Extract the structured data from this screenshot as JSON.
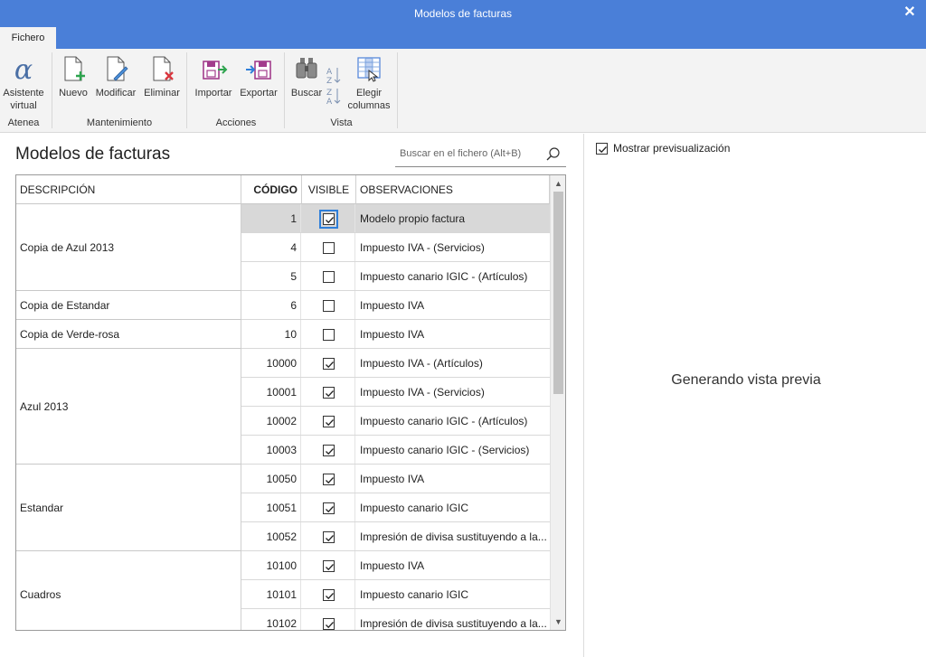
{
  "window": {
    "title": "Modelos de facturas",
    "close_glyph": "✕"
  },
  "tabs": [
    {
      "label": "Fichero"
    }
  ],
  "ribbon": {
    "groups": [
      {
        "label": "Atenea"
      },
      {
        "label": "Mantenimiento"
      },
      {
        "label": "Acciones"
      },
      {
        "label": "Vista"
      }
    ],
    "buttons": {
      "asistente": {
        "label1": "Asistente",
        "label2": "virtual",
        "icon": "alpha-icon"
      },
      "nuevo": {
        "label": "Nuevo",
        "icon": "new-document-icon"
      },
      "modificar": {
        "label": "Modificar",
        "icon": "edit-document-icon"
      },
      "eliminar": {
        "label": "Eliminar",
        "icon": "delete-document-icon"
      },
      "importar": {
        "label": "Importar",
        "icon": "import-icon"
      },
      "exportar": {
        "label": "Exportar",
        "icon": "export-icon"
      },
      "buscar": {
        "label": "Buscar",
        "icon": "binoculars-icon"
      },
      "ordenar": {
        "icon": "sort-az-icon"
      },
      "elegir": {
        "label1": "Elegir",
        "label2": "columnas",
        "icon": "choose-columns-icon"
      }
    }
  },
  "main": {
    "title": "Modelos de facturas",
    "search": {
      "placeholder": "Buscar en el fichero (Alt+B)",
      "icon": "search-icon"
    },
    "columns": {
      "descripcion": "DESCRIPCIÓN",
      "codigo": "CÓDIGO",
      "visible": "VISIBLE",
      "observaciones": "OBSERVACIONES"
    },
    "groups": [
      {
        "label": "Copia de Azul 2013",
        "rows": 3
      },
      {
        "label": "Copia de Estandar",
        "rows": 1
      },
      {
        "label": "Copia de Verde-rosa",
        "rows": 1
      },
      {
        "label": "Azul 2013",
        "rows": 4
      },
      {
        "label": "Estandar",
        "rows": 3
      },
      {
        "label": "Cuadros",
        "rows": 3
      }
    ],
    "rows": [
      {
        "code": "1",
        "visible": true,
        "obs": "Modelo propio factura",
        "selected": true
      },
      {
        "code": "4",
        "visible": false,
        "obs": "Impuesto IVA - (Servicios)"
      },
      {
        "code": "5",
        "visible": false,
        "obs": "Impuesto canario IGIC - (Artículos)"
      },
      {
        "code": "6",
        "visible": false,
        "obs": "Impuesto IVA"
      },
      {
        "code": "10",
        "visible": false,
        "obs": "Impuesto IVA"
      },
      {
        "code": "10000",
        "visible": true,
        "obs": "Impuesto IVA - (Artículos)"
      },
      {
        "code": "10001",
        "visible": true,
        "obs": "Impuesto IVA - (Servicios)"
      },
      {
        "code": "10002",
        "visible": true,
        "obs": "Impuesto canario IGIC - (Artículos)"
      },
      {
        "code": "10003",
        "visible": true,
        "obs": "Impuesto canario IGIC - (Servicios)"
      },
      {
        "code": "10050",
        "visible": true,
        "obs": "Impuesto IVA"
      },
      {
        "code": "10051",
        "visible": true,
        "obs": "Impuesto canario IGIC"
      },
      {
        "code": "10052",
        "visible": true,
        "obs": "Impresión de divisa sustituyendo a la..."
      },
      {
        "code": "10100",
        "visible": true,
        "obs": "Impuesto IVA"
      },
      {
        "code": "10101",
        "visible": true,
        "obs": "Impuesto canario IGIC"
      },
      {
        "code": "10102",
        "visible": true,
        "obs": "Impresión de divisa sustituyendo a la..."
      }
    ],
    "scroll_up_glyph": "▲",
    "scroll_down_glyph": "▼"
  },
  "preview": {
    "checkbox_label": "Mostrar previsualización",
    "checked": true,
    "status": "Generando vista previa"
  },
  "colors": {
    "accent": "#4a7fd8",
    "selection": "#d8d8d8",
    "focus": "#2f7fd9"
  }
}
